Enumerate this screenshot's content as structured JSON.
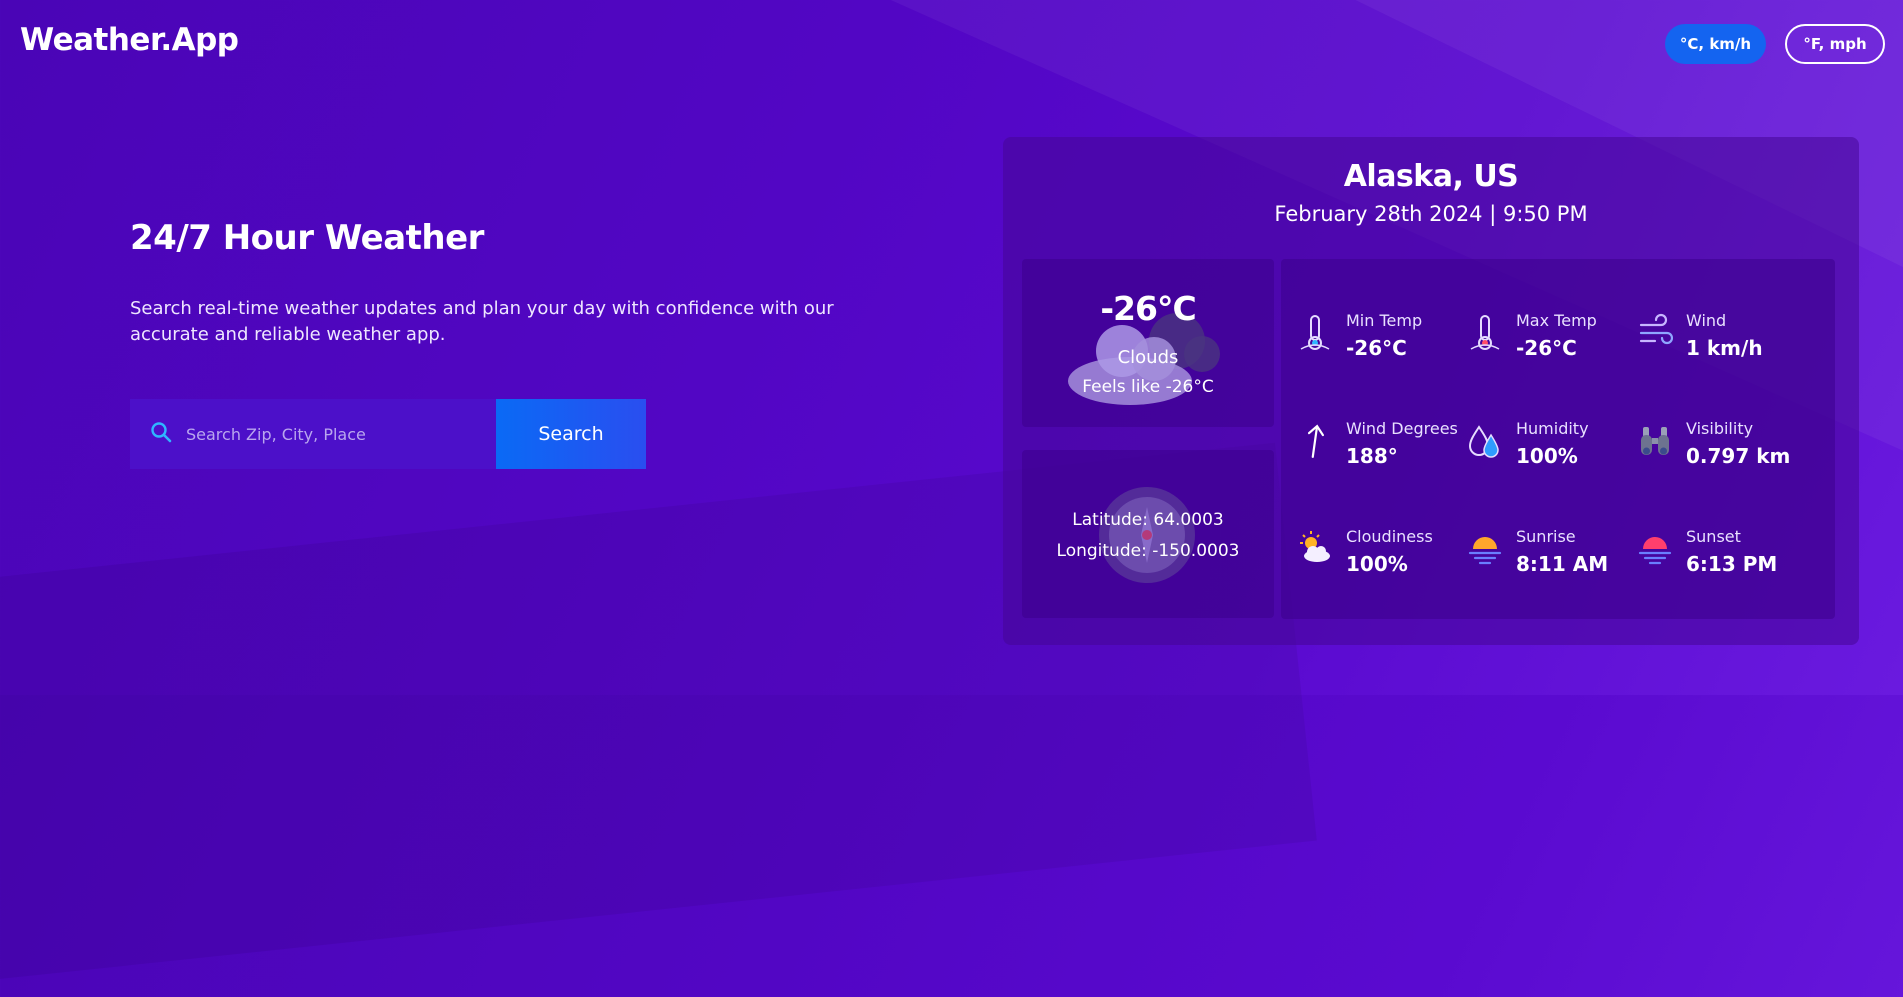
{
  "header": {
    "logo": "Weather.App",
    "metric_label": "°C, km/h",
    "imperial_label": "°F, mph"
  },
  "hero": {
    "title": "24/7 Hour Weather",
    "description": "Search real-time weather updates and plan your day with confidence with our accurate and reliable weather app."
  },
  "search": {
    "placeholder": "Search Zip, City, Place",
    "value": "",
    "button_label": "Search"
  },
  "weather": {
    "location": "Alaska, US",
    "datetime": "February 28th 2024 | 9:50 PM",
    "temperature": "-26°C",
    "condition": "Clouds",
    "feels_like": "Feels like -26°C",
    "latitude": "Latitude: 64.0003",
    "longitude": "Longitude: -150.0003",
    "details": [
      {
        "label": "Min Temp",
        "value": "-26°C",
        "icon": "thermometer-icon"
      },
      {
        "label": "Max Temp",
        "value": "-26°C",
        "icon": "thermometer-icon"
      },
      {
        "label": "Wind",
        "value": "1 km/h",
        "icon": "wind-icon"
      },
      {
        "label": "Wind Degrees",
        "value": "188°",
        "icon": "arrow-up-icon"
      },
      {
        "label": "Humidity",
        "value": "100%",
        "icon": "humidity-drops-icon"
      },
      {
        "label": "Visibility",
        "value": "0.797 km",
        "icon": "binoculars-icon"
      },
      {
        "label": "Cloudiness",
        "value": "100%",
        "icon": "sun-cloud-icon"
      },
      {
        "label": "Sunrise",
        "value": "8:11 AM",
        "icon": "sunrise-icon"
      },
      {
        "label": "Sunset",
        "value": "6:13 PM",
        "icon": "sunset-icon"
      }
    ]
  },
  "colors": {
    "background": "#5206c4",
    "accent_blue": "#1464f0",
    "card": "#46059a"
  }
}
